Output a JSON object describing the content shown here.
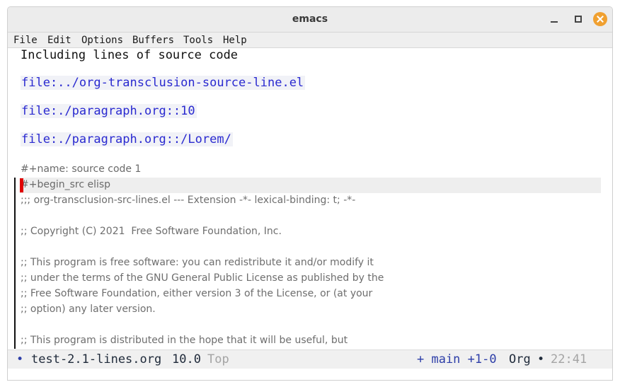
{
  "window": {
    "title": "emacs"
  },
  "menu": [
    "File",
    "Edit",
    "Options",
    "Buffers",
    "Tools",
    "Help"
  ],
  "buffer": {
    "heading": "Including lines of source code",
    "links": [
      "file:../org-transclusion-source-line.el",
      "file:./paragraph.org::10",
      "file:./paragraph.org::/Lorem/"
    ],
    "name_line": "#+name: source code 1",
    "begin_src": "#+begin_src elisp",
    "code_lines": [
      ";;; org-transclusion-src-lines.el --- Extension -*- lexical-binding: t; -*-",
      ";; Copyright (C) 2021  Free Software Foundation, Inc.",
      ";; This program is free software: you can redistribute it and/or modify it",
      ";; under the terms of the GNU General Public License as published by the",
      ";; Free Software Foundation, either version 3 of the License, or (at your",
      ";; option) any later version.",
      ";; This program is distributed in the hope that it will be useful, but"
    ]
  },
  "modeline": {
    "bullet": "•",
    "buffer_name": "test-2.1-lines.org",
    "position": "10.0",
    "scroll": "Top",
    "vc": "+ main +1-0",
    "mode": "Org",
    "sep": "•",
    "time": "22:41"
  },
  "colors": {
    "link": "#2a2ad0",
    "cursor": "#e00000",
    "close_button": "#f0a030"
  }
}
